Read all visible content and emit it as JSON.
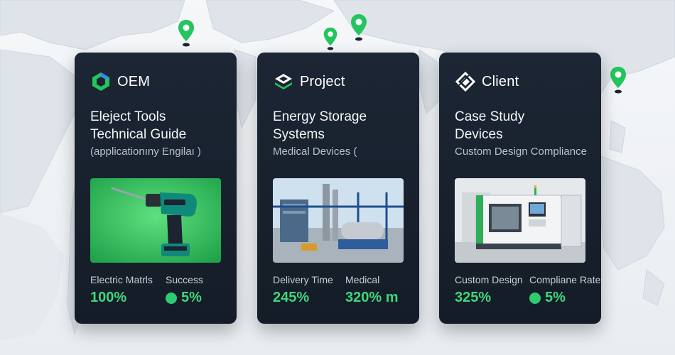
{
  "colors": {
    "accent": "#3ed67c",
    "card_bg": "#1a2330",
    "pin": "#22c55e"
  },
  "cards": [
    {
      "logo_icon": "hexagon-logo-icon",
      "label": "OEM",
      "title_line1": "Eleject Tools",
      "title_line2": "Technical Guide",
      "subtitle": "(applicationıny Engilaı )",
      "image": "drill-image",
      "stat1_label": "Electric Matrls",
      "stat1_value": "100%",
      "stat2_label": "Success",
      "stat2_value": "5%"
    },
    {
      "logo_icon": "layers-logo-icon",
      "label": "Project",
      "title_line1": "Energy Storage",
      "title_line2": "Systems",
      "subtitle": "Medical Devices (",
      "image": "industrial-plant-image",
      "stat1_label": "Delivery Time",
      "stat1_value": "245%",
      "stat2_label": "Medical",
      "stat2_value": "320% m"
    },
    {
      "logo_icon": "diamond-logo-icon",
      "label": "Client",
      "title_line1": "Case Study",
      "title_line2": "Devices",
      "subtitle": "Custom Design Compliance",
      "image": "cnc-machine-image",
      "stat1_label": "Custom Design",
      "stat1_value": "325%",
      "stat2_label": "Compliane Rate",
      "stat2_value": "5%"
    }
  ]
}
